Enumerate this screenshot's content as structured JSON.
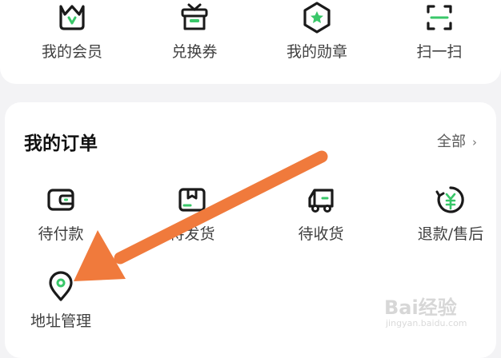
{
  "top_row": [
    {
      "label": "我的会员",
      "icon": "crown-bag-icon"
    },
    {
      "label": "兑换券",
      "icon": "gift-box-icon"
    },
    {
      "label": "我的勋章",
      "icon": "medal-hexagon-icon"
    },
    {
      "label": "扫一扫",
      "icon": "scan-frame-icon"
    }
  ],
  "orders": {
    "title": "我的订单",
    "all_label": "全部",
    "chevron": "›",
    "items": [
      {
        "label": "待付款",
        "icon": "wallet-icon"
      },
      {
        "label": "待发货",
        "icon": "package-icon"
      },
      {
        "label": "待收货",
        "icon": "truck-icon"
      },
      {
        "label": "退款/售后",
        "icon": "refund-yuan-icon"
      },
      {
        "label": "地址管理",
        "icon": "location-pin-icon"
      }
    ]
  },
  "annotation": {
    "type": "arrow",
    "color": "#f07a3c"
  },
  "watermark": {
    "main": "Bai经验",
    "sub": "jingyan.baidu.com"
  },
  "colors": {
    "accent": "#39c769",
    "icon_stroke": "#1a1a1a",
    "background": "#f3f3f5",
    "card": "#ffffff"
  }
}
